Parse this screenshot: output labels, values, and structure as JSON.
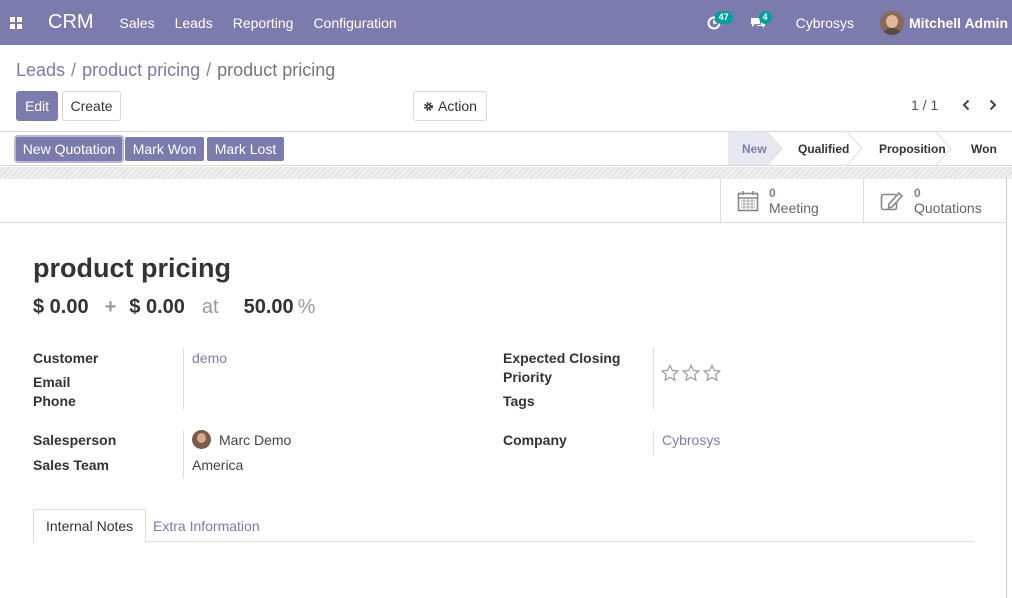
{
  "navbar": {
    "app_name": "CRM",
    "menu": [
      "Sales",
      "Leads",
      "Reporting",
      "Configuration"
    ],
    "activity_count": "47",
    "message_count": "4",
    "company": "Cybrosys",
    "user": "Mitchell Admin"
  },
  "breadcrumb": {
    "items": [
      "Leads",
      "product pricing",
      "product pricing"
    ],
    "separator": "/"
  },
  "buttons": {
    "edit": "Edit",
    "create": "Create",
    "action": "Action"
  },
  "pager": {
    "value": "1 / 1"
  },
  "statusbar": {
    "buttons": [
      "New Quotation",
      "Mark Won",
      "Mark Lost"
    ],
    "stages": [
      "New",
      "Qualified",
      "Proposition",
      "Won"
    ],
    "active_stage": "New"
  },
  "smart_buttons": {
    "meeting": {
      "count": "0",
      "label": "Meeting"
    },
    "quotations": {
      "count": "0",
      "label": "Quotations"
    }
  },
  "lead": {
    "title": "product pricing",
    "expected_revenue": "$ 0.00",
    "plus": "+",
    "recurring_revenue": "$ 0.00",
    "at": "at",
    "probability": "50.00",
    "percent": "%"
  },
  "fields": {
    "customer_label": "Customer",
    "customer_value": "demo",
    "email_label": "Email",
    "phone_label": "Phone",
    "expected_closing_label": "Expected Closing",
    "priority_label": "Priority",
    "tags_label": "Tags",
    "salesperson_label": "Salesperson",
    "salesperson_value": "Marc Demo",
    "sales_team_label": "Sales Team",
    "sales_team_value": "America",
    "company_label": "Company",
    "company_value": "Cybrosys"
  },
  "tabs": [
    "Internal Notes",
    "Extra Information"
  ],
  "colors": {
    "brand": "#7c7bad",
    "badge": "#00a09d"
  }
}
